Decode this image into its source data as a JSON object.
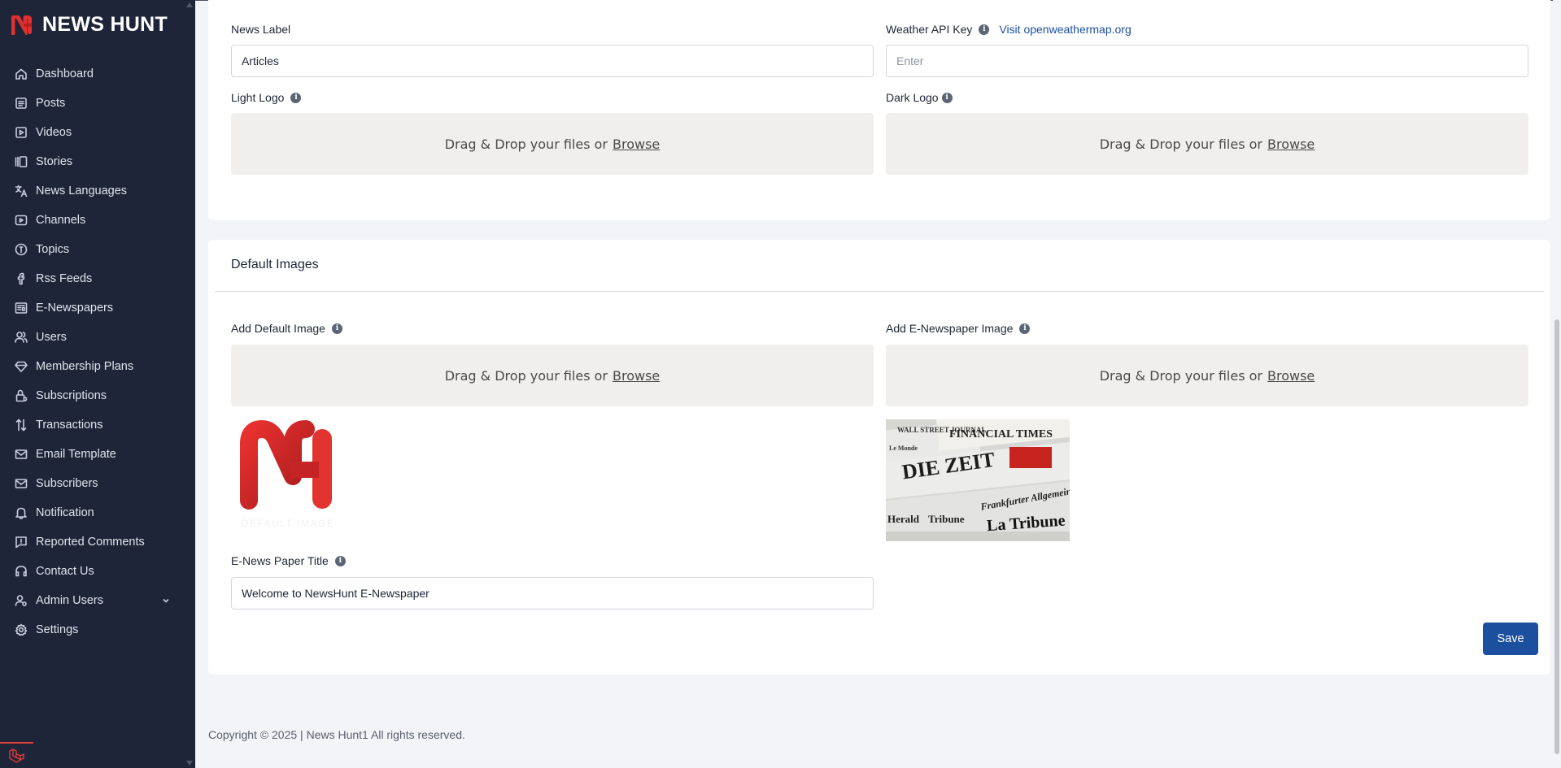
{
  "brand": {
    "name": "NEWS HUNT",
    "accent": "#e0302f"
  },
  "sidebar": {
    "items": [
      {
        "label": "Dashboard",
        "icon": "home-icon"
      },
      {
        "label": "Posts",
        "icon": "list-icon"
      },
      {
        "label": "Videos",
        "icon": "video-icon"
      },
      {
        "label": "Stories",
        "icon": "stories-icon"
      },
      {
        "label": "News Languages",
        "icon": "language-icon"
      },
      {
        "label": "Channels",
        "icon": "channel-icon"
      },
      {
        "label": "Topics",
        "icon": "topic-icon"
      },
      {
        "label": "Rss Feeds",
        "icon": "rss-icon"
      },
      {
        "label": "E-Newspapers",
        "icon": "newspaper-icon"
      },
      {
        "label": "Users",
        "icon": "users-icon"
      },
      {
        "label": "Membership Plans",
        "icon": "diamond-icon"
      },
      {
        "label": "Subscriptions",
        "icon": "lock-icon"
      },
      {
        "label": "Transactions",
        "icon": "transactions-icon"
      },
      {
        "label": "Email Template",
        "icon": "mail-icon"
      },
      {
        "label": "Subscribers",
        "icon": "mail-icon"
      },
      {
        "label": "Notification",
        "icon": "bell-icon"
      },
      {
        "label": "Reported Comments",
        "icon": "comment-alert-icon"
      },
      {
        "label": "Contact Us",
        "icon": "headset-icon"
      },
      {
        "label": "Admin Users",
        "icon": "admin-user-icon"
      },
      {
        "label": "Settings",
        "icon": "gear-icon"
      }
    ]
  },
  "settings": {
    "news_label": {
      "label": "News Label",
      "value": "Articles"
    },
    "weather": {
      "label": "Weather API Key",
      "link": "Visit openweathermap.org",
      "placeholder": "Enter"
    },
    "light_logo": {
      "label": "Light Logo"
    },
    "dark_logo": {
      "label": "Dark Logo"
    },
    "dropzone": {
      "text": "Drag & Drop your files or",
      "browse": "Browse"
    }
  },
  "default_images": {
    "title": "Default Images",
    "default_image": {
      "label": "Add Default Image"
    },
    "enewspaper_image": {
      "label": "Add E-Newspaper Image"
    },
    "enews_title": {
      "label": "E-News Paper Title",
      "value": "Welcome to NewsHunt E-Newspaper"
    },
    "save": "Save",
    "preview_caption": "DEFAULT IMAGE",
    "newspaper_headlines": [
      "FINANCIAL TIMES",
      "DIE ZEIT",
      "Frankfurter Allgemeine",
      "Herald",
      "Tribune",
      "La Tribune",
      "WALL STREET JOURNAL",
      "Le Monde"
    ]
  },
  "footer": {
    "text": "Copyright © 2025 | News Hunt1 All rights reserved."
  }
}
